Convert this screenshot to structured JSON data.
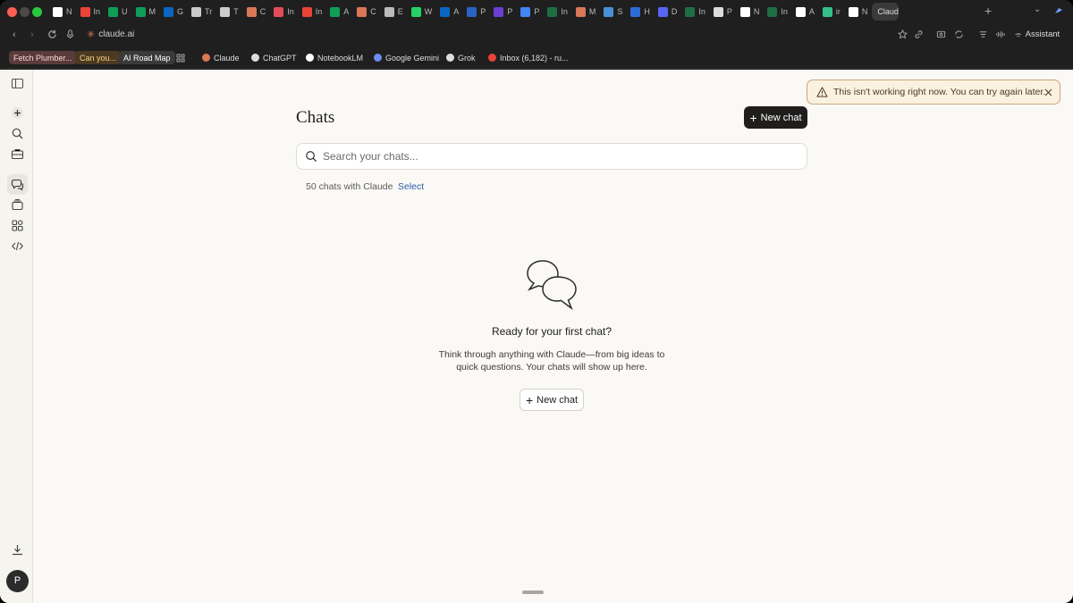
{
  "browser": {
    "tabs": [
      {
        "icon": "notion-icon",
        "label": "N",
        "color": "#ffffff"
      },
      {
        "icon": "gmail-icon",
        "label": "In",
        "color": "#ea4335"
      },
      {
        "icon": "sheets-icon",
        "label": "U",
        "color": "#0f9d58"
      },
      {
        "icon": "sheets-icon",
        "label": "M",
        "color": "#0f9d58"
      },
      {
        "icon": "linkedin-icon",
        "label": "G",
        "color": "#0a66c2"
      },
      {
        "icon": "openai-icon",
        "label": "Tr",
        "color": "#cccccc"
      },
      {
        "icon": "tesla-icon",
        "label": "T",
        "color": "#cccccc"
      },
      {
        "icon": "claude-icon",
        "label": "C",
        "color": "#d97757"
      },
      {
        "icon": "circle-icon",
        "label": "In",
        "color": "#e34b5a"
      },
      {
        "icon": "gmail-icon",
        "label": "In",
        "color": "#ea4335"
      },
      {
        "icon": "sheets-icon",
        "label": "A",
        "color": "#0f9d58"
      },
      {
        "icon": "claude-icon",
        "label": "C",
        "color": "#d97757"
      },
      {
        "icon": "robot-icon",
        "label": "E",
        "color": "#bbbbbb"
      },
      {
        "icon": "whatsapp-icon",
        "label": "W",
        "color": "#25d366"
      },
      {
        "icon": "linkedin-icon",
        "label": "A",
        "color": "#0a66c2"
      },
      {
        "icon": "perplexity-icon",
        "label": "P",
        "color": "#2a63c5"
      },
      {
        "icon": "perplexity-icon",
        "label": "P",
        "color": "#6a3fd1"
      },
      {
        "icon": "calendar-icon",
        "label": "P",
        "color": "#4285f4"
      },
      {
        "icon": "excel-icon",
        "label": "In",
        "color": "#1d6f42"
      },
      {
        "icon": "claude-icon",
        "label": "M",
        "color": "#d97757"
      },
      {
        "icon": "chart-icon",
        "label": "S",
        "color": "#4a90d9"
      },
      {
        "icon": "atlassian-icon",
        "label": "H",
        "color": "#2f6bd8"
      },
      {
        "icon": "discord-icon",
        "label": "D",
        "color": "#5865f2"
      },
      {
        "icon": "excel-icon",
        "label": "In",
        "color": "#1d6f42"
      },
      {
        "icon": "chatgpt-icon",
        "label": "P",
        "color": "#dddddd"
      },
      {
        "icon": "notebooklm-icon",
        "label": "N",
        "color": "#ffffff"
      },
      {
        "icon": "excel-icon",
        "label": "In",
        "color": "#1d6f42"
      },
      {
        "icon": "plus-box-icon",
        "label": "A",
        "color": "#ffffff"
      },
      {
        "icon": "zap-icon",
        "label": "ir",
        "color": "#35c08b"
      },
      {
        "icon": "notion-icon",
        "label": "N",
        "color": "#ffffff"
      },
      {
        "icon": "claude-icon",
        "label": "Claud",
        "color": "#d97757",
        "active": true
      }
    ],
    "url": "claude.ai",
    "assistant_label": "Assistant"
  },
  "bookmarks": [
    {
      "label": "Fetch Plumber...",
      "bg": "#5a3a3a",
      "fg": "#ffd7d7",
      "pill": true
    },
    {
      "label": "Can you...",
      "bg": "#4a3a22",
      "fg": "#ffcf86",
      "pill": true
    },
    {
      "label": "AI Road Map",
      "bg": "#3a3a3a",
      "fg": "#ffffff",
      "pill": true
    },
    {
      "label": "Claude",
      "icon": "claude-icon",
      "color": "#d97757"
    },
    {
      "label": "ChatGPT",
      "icon": "chatgpt-icon",
      "color": "#dddddd"
    },
    {
      "label": "NotebookLM",
      "icon": "notebooklm-icon",
      "color": "#ffffff"
    },
    {
      "label": "Google Gemini",
      "icon": "gemini-icon",
      "color": "#6d8df2"
    },
    {
      "label": "Grok",
      "icon": "grok-icon",
      "color": "#dddddd"
    },
    {
      "label": "Inbox (6,182) - ru...",
      "icon": "gmail-icon",
      "color": "#ea4335"
    }
  ],
  "main": {
    "title": "Chats",
    "new_chat_label": "New chat",
    "search_placeholder": "Search your chats...",
    "count_text": "50 chats with Claude",
    "select_label": "Select",
    "empty_title": "Ready for your first chat?",
    "empty_desc_line1": "Think through anything with Claude—from big ideas to",
    "empty_desc_line2": "quick questions. Your chats will show up here.",
    "empty_new_chat_label": "New chat"
  },
  "toast": {
    "text": "This isn't working right now. You can try again later."
  },
  "sidebar": {
    "avatar_initial": "P"
  }
}
